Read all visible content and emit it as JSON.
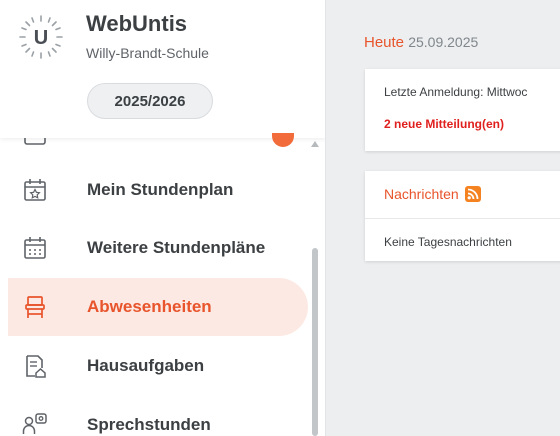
{
  "app": {
    "name": "WebUntis",
    "school": "Willy-Brandt-Schule",
    "school_year": "2025/2026",
    "accent_color": "#e8542b"
  },
  "sidebar": {
    "items": [
      {
        "label": "Mein Stundenplan",
        "icon": "calendar-star-icon",
        "active": false
      },
      {
        "label": "Weitere Stundenpläne",
        "icon": "calendar-grid-icon",
        "active": false
      },
      {
        "label": "Abwesenheiten",
        "icon": "chair-icon",
        "active": true
      },
      {
        "label": "Hausaufgaben",
        "icon": "homework-icon",
        "active": false
      },
      {
        "label": "Sprechstunden",
        "icon": "consultation-icon",
        "active": false
      }
    ]
  },
  "main": {
    "today_label": "Heute",
    "today_date": "25.09.2025",
    "login_card": {
      "last_login": "Letzte Anmeldung: Mittwoc",
      "new_messages": "2 neue Mitteilung(en)"
    },
    "news_card": {
      "title": "Nachrichten",
      "icon": "rss-icon",
      "empty_text": "Keine Tagesnachrichten"
    }
  }
}
